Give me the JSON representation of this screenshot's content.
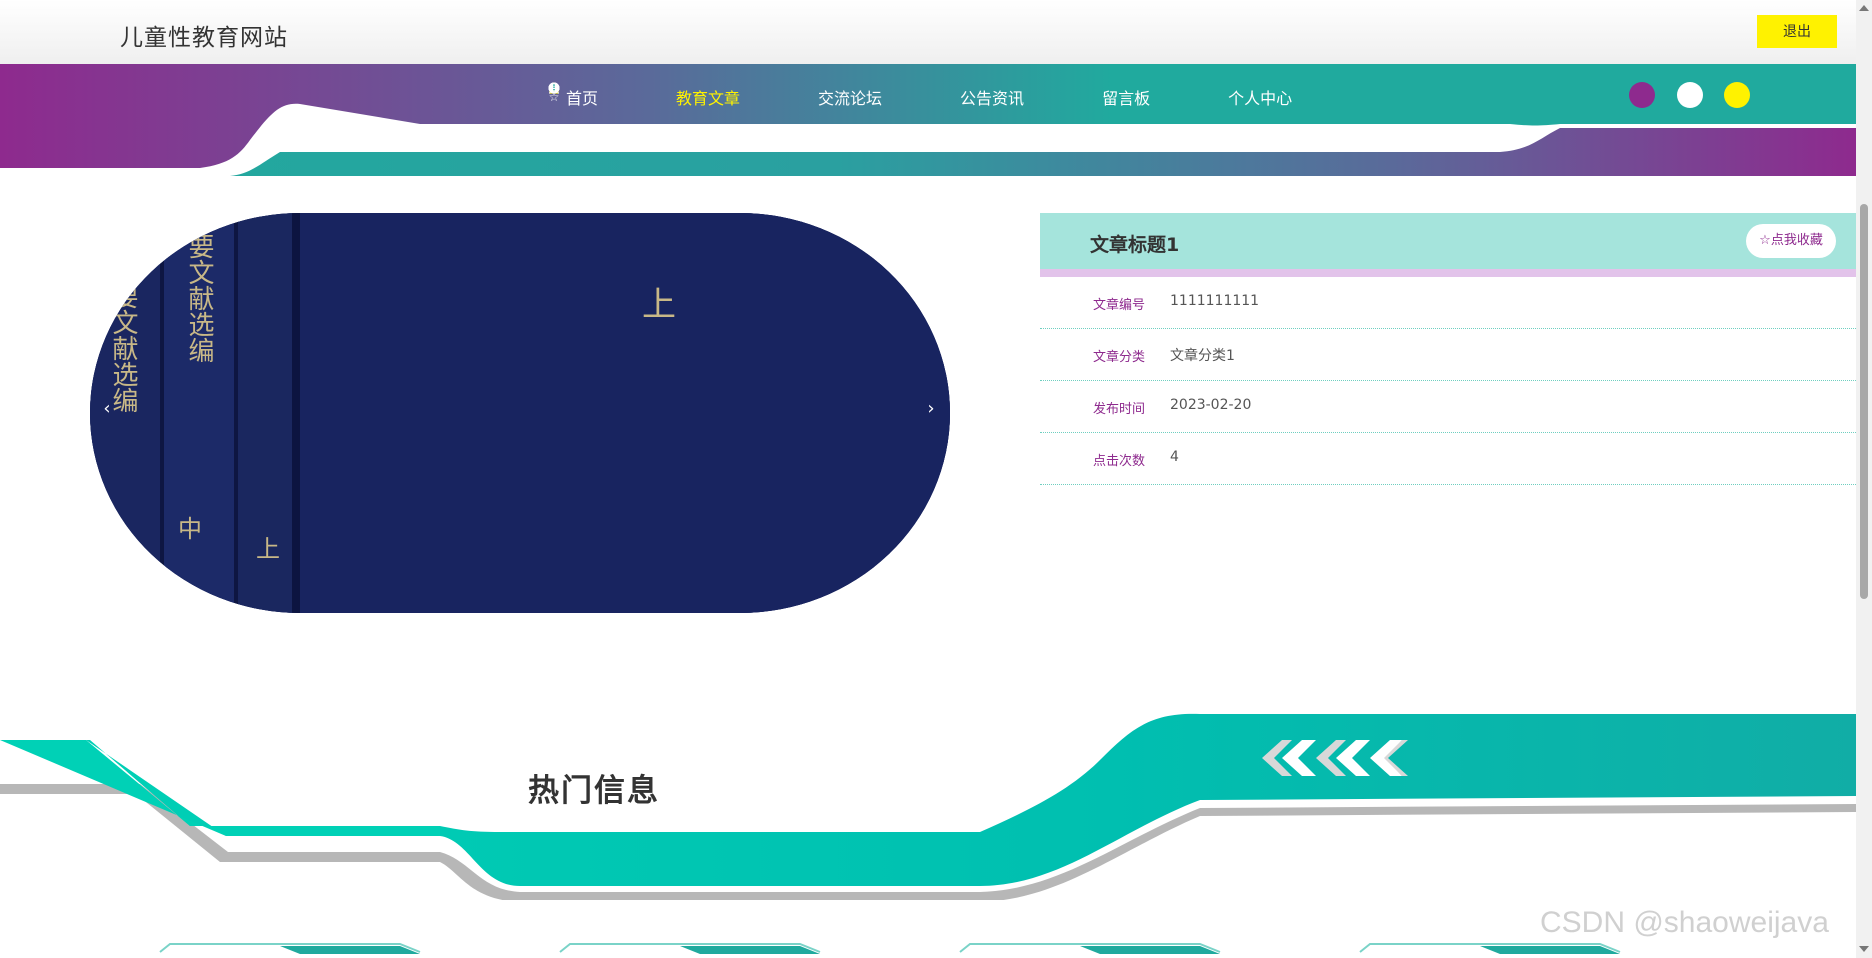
{
  "header": {
    "site_title": "儿童性教育网站",
    "logout_label": "退出"
  },
  "nav": {
    "items": [
      {
        "label": "首页",
        "icon": "star-icon",
        "active": false
      },
      {
        "label": "教育文章",
        "icon": "bag-icon",
        "active": true
      },
      {
        "label": "交流论坛",
        "icon": "alert-icon",
        "active": false
      },
      {
        "label": "公告资讯",
        "icon": "help-icon",
        "active": false
      },
      {
        "label": "留言板",
        "icon": "info-icon",
        "active": false
      },
      {
        "label": "个人中心",
        "icon": "user-icon",
        "active": false
      }
    ],
    "theme_colors": [
      "#8e2a8e",
      "#ffffff",
      "#fff200"
    ]
  },
  "carousel": {
    "prev_glyph": "‹",
    "next_glyph": "›",
    "slide_count": 3,
    "active_index": 0,
    "cover_text": [
      "上"
    ],
    "spine_texts": [
      "要文献选编",
      "要文献选编"
    ]
  },
  "article": {
    "title": "文章标题1",
    "favorite_label": "☆点我收藏",
    "fields": [
      {
        "label": "文章编号",
        "value": "1111111111"
      },
      {
        "label": "文章分类",
        "value": "文章分类1"
      },
      {
        "label": "发布时间",
        "value": "2023-02-20"
      },
      {
        "label": "点击次数",
        "value": "4"
      }
    ]
  },
  "hot": {
    "title": "热门信息"
  },
  "watermark": "CSDN @shaoweijava",
  "colors": {
    "teal": "#20aa9e",
    "purple": "#8e2a8e",
    "yellow": "#fff200",
    "section_teal": "#00c4b0"
  }
}
